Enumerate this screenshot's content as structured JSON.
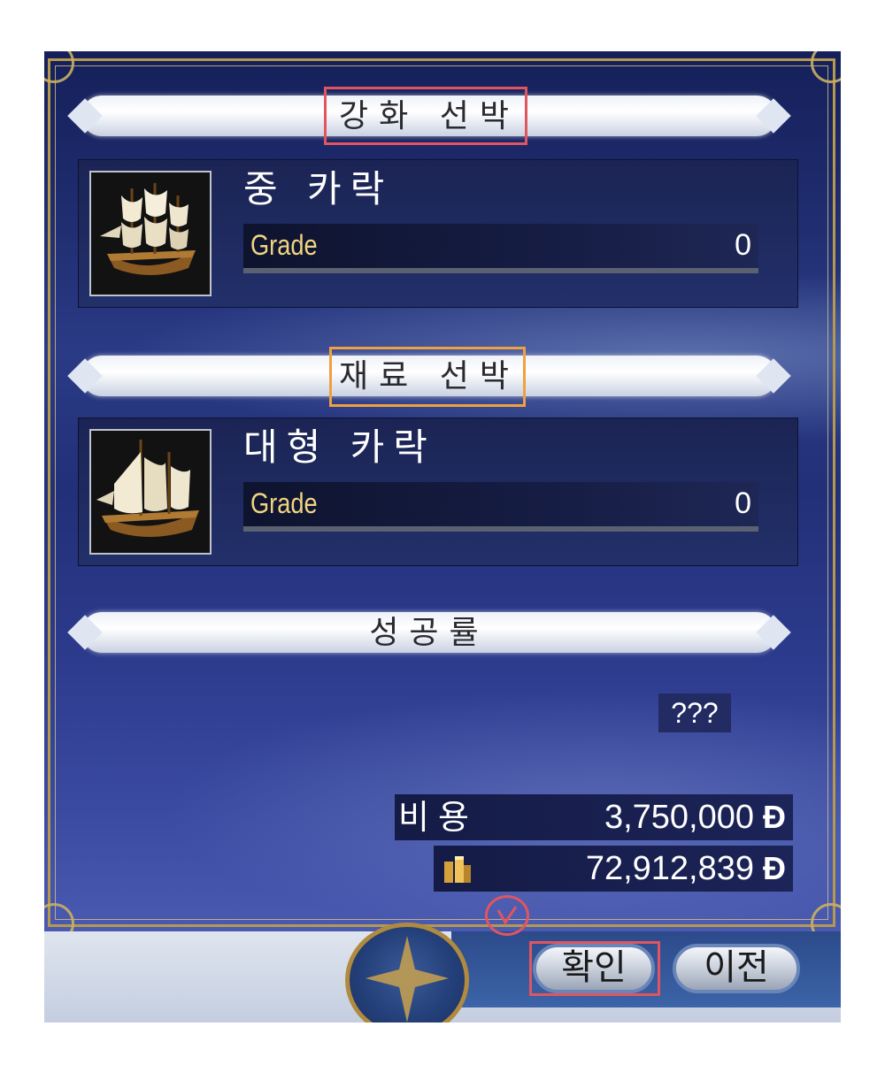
{
  "enhance_section": {
    "title": "강화 선박",
    "ship_name": "중 카락",
    "grade_label": "Grade",
    "grade_value": "0"
  },
  "material_section": {
    "title": "재료 선박",
    "ship_name": "대형 카락",
    "grade_label": "Grade",
    "grade_value": "0"
  },
  "success_section": {
    "title": "성공률",
    "rate": "???"
  },
  "cost": {
    "label": "비용",
    "amount": "3,750,000",
    "currency": "Đ"
  },
  "wallet": {
    "icon": "gold-bars-icon",
    "amount": "72,912,839",
    "currency": "Đ"
  },
  "buttons": {
    "confirm": "확인",
    "previous": "이전"
  },
  "colors": {
    "panel": "#2a3a85",
    "frame": "#b59a4d",
    "grade_label": "#f0d480",
    "annotation_red": "#e05560",
    "annotation_orange": "#f0a040"
  }
}
